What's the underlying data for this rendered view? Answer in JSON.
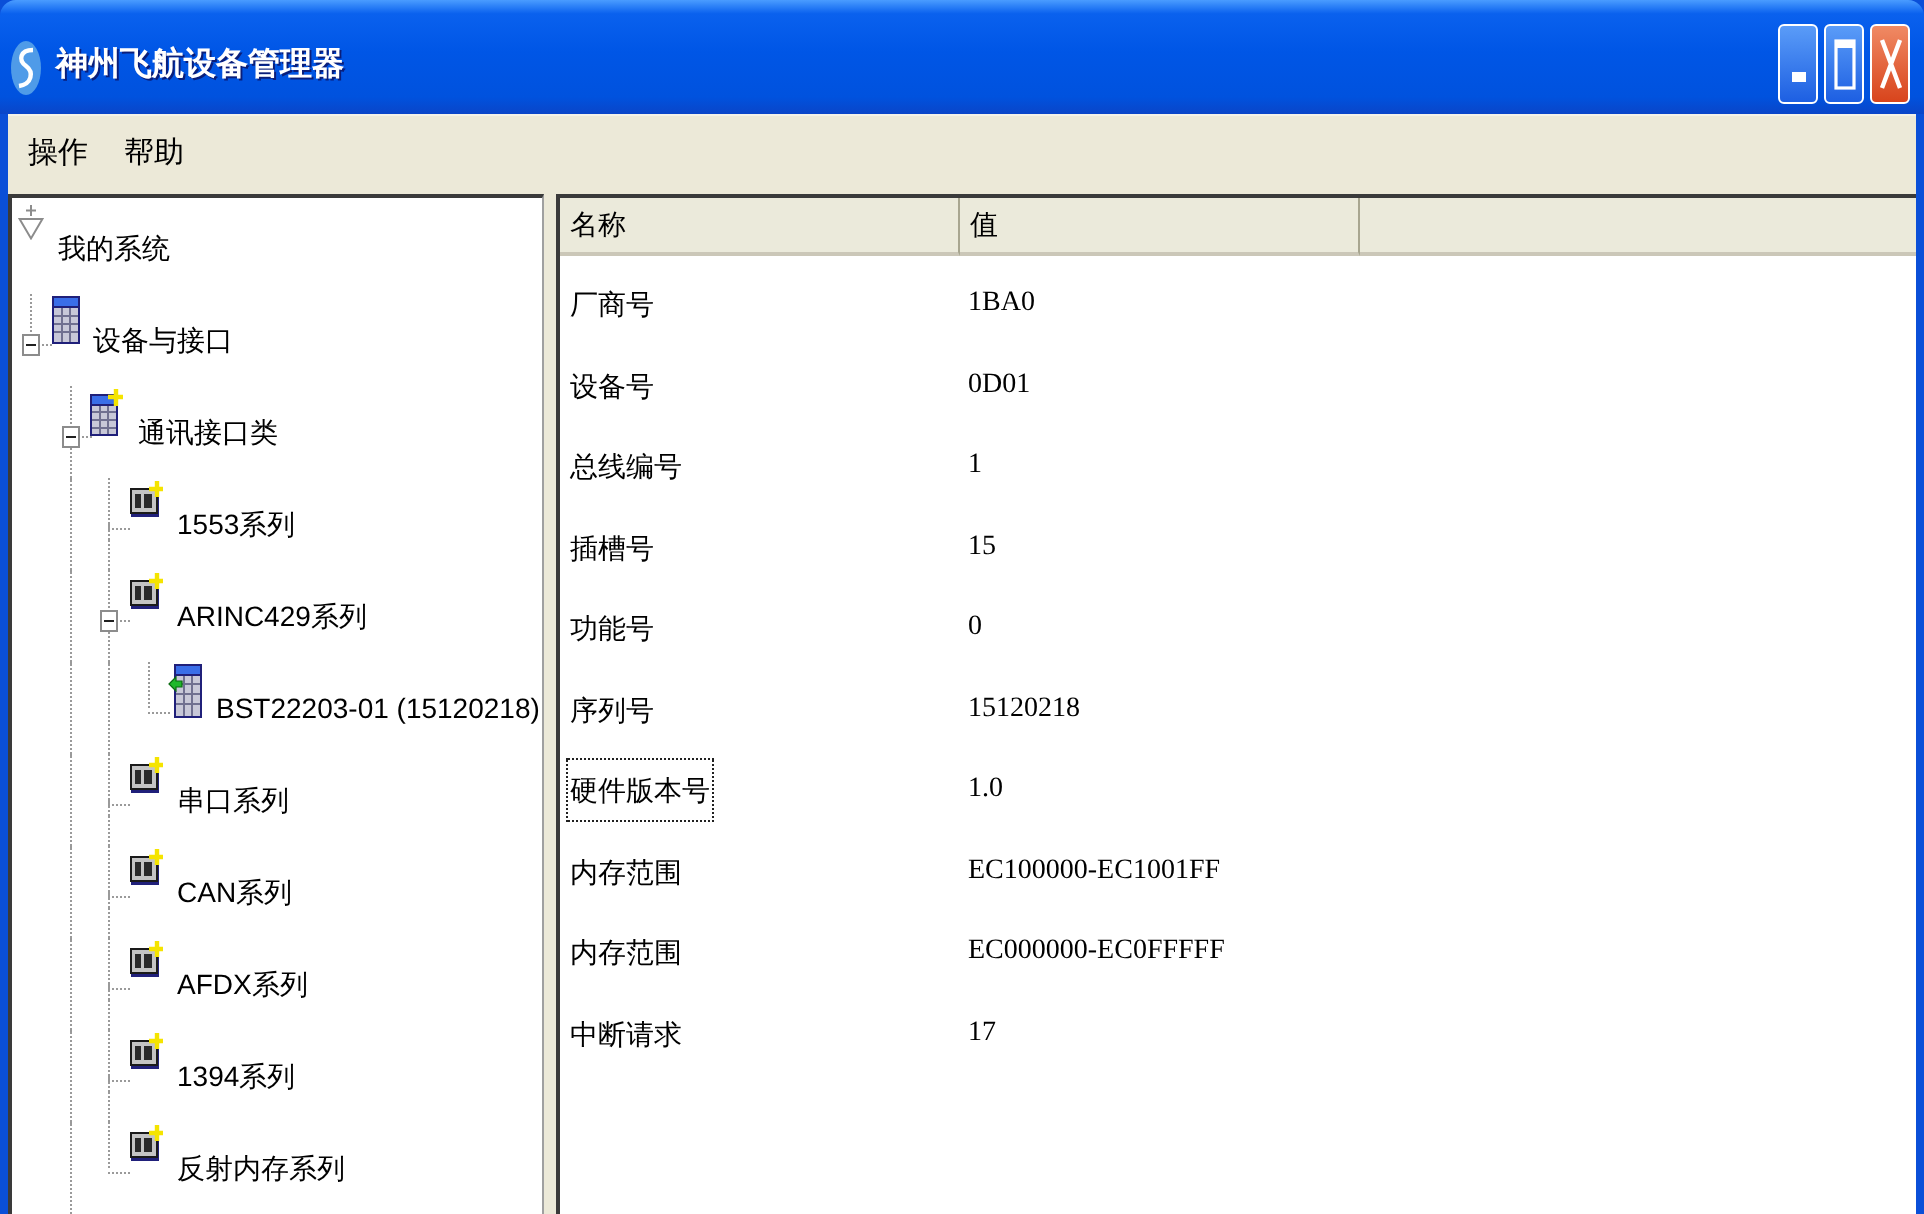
{
  "window": {
    "title": "神州飞航设备管理器"
  },
  "menu": [
    "操作",
    "帮助"
  ],
  "tree": [
    {
      "label": "我的系统",
      "kind": "system",
      "children": [
        {
          "label": "设备与接口",
          "kind": "group",
          "expanded": true,
          "children": [
            {
              "label": "通讯接口类",
              "kind": "category",
              "expanded": true,
              "more_below": true,
              "children": [
                {
                  "label": "1553系列",
                  "kind": "series"
                },
                {
                  "label": "ARINC429系列",
                  "kind": "series",
                  "expanded": true,
                  "children": [
                    {
                      "label": "BST22203-01 (15120218)",
                      "kind": "device"
                    }
                  ]
                },
                {
                  "label": "串口系列",
                  "kind": "series"
                },
                {
                  "label": "CAN系列",
                  "kind": "series"
                },
                {
                  "label": "AFDX系列",
                  "kind": "series"
                },
                {
                  "label": "1394系列",
                  "kind": "series"
                },
                {
                  "label": "反射内存系列",
                  "kind": "series"
                }
              ]
            }
          ]
        }
      ]
    }
  ],
  "table": {
    "columns": [
      "名称",
      "值"
    ],
    "rows": [
      {
        "name": "厂商号",
        "value": "1BA0",
        "focused": false
      },
      {
        "name": "设备号",
        "value": "0D01",
        "focused": false
      },
      {
        "name": "总线编号",
        "value": "1",
        "focused": false
      },
      {
        "name": "插槽号",
        "value": "15",
        "focused": false
      },
      {
        "name": "功能号",
        "value": "0",
        "focused": false
      },
      {
        "name": "序列号",
        "value": "15120218",
        "focused": false
      },
      {
        "name": "硬件版本号",
        "value": "1.0",
        "focused": true
      },
      {
        "name": "内存范围",
        "value": "EC100000-EC1001FF",
        "focused": false
      },
      {
        "name": "内存范围",
        "value": "EC000000-EC0FFFFF",
        "focused": false
      },
      {
        "name": "中断请求",
        "value": "17",
        "focused": false
      }
    ]
  }
}
